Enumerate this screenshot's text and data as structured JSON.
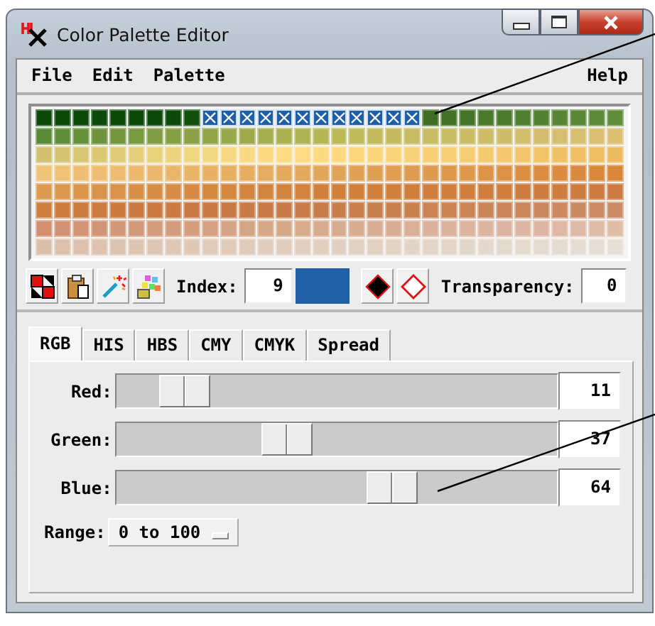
{
  "window": {
    "title": "Color Palette Editor"
  },
  "menu": [
    {
      "label": "File"
    },
    {
      "label": "Edit"
    },
    {
      "label": "Palette"
    },
    {
      "label": "Help"
    }
  ],
  "palette": {
    "rows": [
      {
        "cells": [
          {
            "color": "#0d4a0a",
            "selected": false
          },
          {
            "color": "#0d4a0a",
            "selected": false
          },
          {
            "color": "#0d4a0a",
            "selected": false
          },
          {
            "color": "#0d4a0a",
            "selected": false
          },
          {
            "color": "#0d4a0a",
            "selected": false
          },
          {
            "color": "#0d4a0a",
            "selected": false
          },
          {
            "color": "#0d4a0a",
            "selected": false
          },
          {
            "color": "#0d4a0a",
            "selected": false
          },
          {
            "color": "#10500c",
            "selected": false
          },
          {
            "color": "#1f5fa6",
            "selected": true
          },
          {
            "color": "#1f5fa6",
            "selected": true
          },
          {
            "color": "#1f5fa6",
            "selected": true
          },
          {
            "color": "#1f5fa6",
            "selected": true
          },
          {
            "color": "#1f5fa6",
            "selected": true
          },
          {
            "color": "#1f5fa6",
            "selected": true
          },
          {
            "color": "#1f5fa6",
            "selected": true
          },
          {
            "color": "#1f5fa6",
            "selected": true
          },
          {
            "color": "#1f5fa6",
            "selected": true
          },
          {
            "color": "#1f5fa6",
            "selected": true
          },
          {
            "color": "#1f5fa6",
            "selected": true
          },
          {
            "color": "#1f5fa6",
            "selected": true
          },
          {
            "color": "#3f6e22",
            "selected": false
          },
          {
            "color": "#437226",
            "selected": false
          },
          {
            "color": "#46752a",
            "selected": false
          },
          {
            "color": "#4a782c",
            "selected": false
          },
          {
            "color": "#4d7b2e",
            "selected": false
          },
          {
            "color": "#507e30",
            "selected": false
          },
          {
            "color": "#538132",
            "selected": false
          },
          {
            "color": "#568434",
            "selected": false
          },
          {
            "color": "#598736",
            "selected": false
          },
          {
            "color": "#5c8a38",
            "selected": false
          },
          {
            "color": "#5f8d3a",
            "selected": false
          }
        ]
      },
      {
        "cells": [
          {
            "color": "#5b8a36",
            "selected": false
          },
          {
            "color": "#618d38",
            "selected": false
          },
          {
            "color": "#67903a",
            "selected": false
          },
          {
            "color": "#6d933c",
            "selected": false
          },
          {
            "color": "#73963e",
            "selected": false
          },
          {
            "color": "#799940",
            "selected": false
          },
          {
            "color": "#7f9c42",
            "selected": false
          },
          {
            "color": "#859f44",
            "selected": false
          },
          {
            "color": "#8ba246",
            "selected": false
          },
          {
            "color": "#91a548",
            "selected": false
          },
          {
            "color": "#97a84a",
            "selected": false
          },
          {
            "color": "#9dab4c",
            "selected": false
          },
          {
            "color": "#a3ae4e",
            "selected": false
          },
          {
            "color": "#a9b150",
            "selected": false
          },
          {
            "color": "#afb452",
            "selected": false
          },
          {
            "color": "#b5b754",
            "selected": false
          },
          {
            "color": "#bbba56",
            "selected": false
          },
          {
            "color": "#bfbb5a",
            "selected": false
          },
          {
            "color": "#c1bb5e",
            "selected": false
          },
          {
            "color": "#c3bb60",
            "selected": false
          },
          {
            "color": "#c5bb62",
            "selected": false
          },
          {
            "color": "#c7bb64",
            "selected": false
          },
          {
            "color": "#c9bc66",
            "selected": false
          },
          {
            "color": "#cbbc68",
            "selected": false
          },
          {
            "color": "#cdbd6a",
            "selected": false
          },
          {
            "color": "#cfbd6c",
            "selected": false
          },
          {
            "color": "#d1be6e",
            "selected": false
          },
          {
            "color": "#d3be70",
            "selected": false
          },
          {
            "color": "#d5bf72",
            "selected": false
          },
          {
            "color": "#d7bf72",
            "selected": false
          },
          {
            "color": "#d9c074",
            "selected": false
          },
          {
            "color": "#dbc074",
            "selected": false
          }
        ]
      },
      {
        "cells": [
          {
            "color": "#d0c070",
            "selected": false
          },
          {
            "color": "#d4c372",
            "selected": false
          },
          {
            "color": "#d8c674",
            "selected": false
          },
          {
            "color": "#dcc976",
            "selected": false
          },
          {
            "color": "#e0cc78",
            "selected": false
          },
          {
            "color": "#e4cf7a",
            "selected": false
          },
          {
            "color": "#e8d27c",
            "selected": false
          },
          {
            "color": "#ecd47e",
            "selected": false
          },
          {
            "color": "#f0d680",
            "selected": false
          },
          {
            "color": "#f3d882",
            "selected": false
          },
          {
            "color": "#f6d984",
            "selected": false
          },
          {
            "color": "#f8da84",
            "selected": false
          },
          {
            "color": "#fadb84",
            "selected": false
          },
          {
            "color": "#fbdb84",
            "selected": false
          },
          {
            "color": "#fcdb84",
            "selected": false
          },
          {
            "color": "#fcda82",
            "selected": false
          },
          {
            "color": "#fcd980",
            "selected": false
          },
          {
            "color": "#fbd87e",
            "selected": false
          },
          {
            "color": "#fad67c",
            "selected": false
          },
          {
            "color": "#f9d47a",
            "selected": false
          },
          {
            "color": "#f8d278",
            "selected": false
          },
          {
            "color": "#f7d076",
            "selected": false
          },
          {
            "color": "#f6ce74",
            "selected": false
          },
          {
            "color": "#f5cc72",
            "selected": false
          },
          {
            "color": "#f4ca70",
            "selected": false
          },
          {
            "color": "#f3c86e",
            "selected": false
          },
          {
            "color": "#f2c66c",
            "selected": false
          },
          {
            "color": "#f1c46a",
            "selected": false
          },
          {
            "color": "#f0c268",
            "selected": false
          },
          {
            "color": "#efc066",
            "selected": false
          },
          {
            "color": "#eebe64",
            "selected": false
          },
          {
            "color": "#edbc62",
            "selected": false
          }
        ]
      },
      {
        "cells": [
          {
            "color": "#f0c478",
            "selected": false
          },
          {
            "color": "#efc276",
            "selected": false
          },
          {
            "color": "#eec074",
            "selected": false
          },
          {
            "color": "#edbe72",
            "selected": false
          },
          {
            "color": "#ecbc70",
            "selected": false
          },
          {
            "color": "#ebba6e",
            "selected": false
          },
          {
            "color": "#eab86c",
            "selected": false
          },
          {
            "color": "#e9b66a",
            "selected": false
          },
          {
            "color": "#e8b468",
            "selected": false
          },
          {
            "color": "#e7b266",
            "selected": false
          },
          {
            "color": "#e6b064",
            "selected": false
          },
          {
            "color": "#e5ae62",
            "selected": false
          },
          {
            "color": "#e4ac60",
            "selected": false
          },
          {
            "color": "#e3aa5e",
            "selected": false
          },
          {
            "color": "#e2a85c",
            "selected": false
          },
          {
            "color": "#e1a65a",
            "selected": false
          },
          {
            "color": "#e0a458",
            "selected": false
          },
          {
            "color": "#e0a256",
            "selected": false
          },
          {
            "color": "#dfa054",
            "selected": false
          },
          {
            "color": "#df9e52",
            "selected": false
          },
          {
            "color": "#de9c50",
            "selected": false
          },
          {
            "color": "#de9a4e",
            "selected": false
          },
          {
            "color": "#dd984c",
            "selected": false
          },
          {
            "color": "#dd964a",
            "selected": false
          },
          {
            "color": "#dc9448",
            "selected": false
          },
          {
            "color": "#dc9246",
            "selected": false
          },
          {
            "color": "#db9044",
            "selected": false
          },
          {
            "color": "#db8e42",
            "selected": false
          },
          {
            "color": "#da8c40",
            "selected": false
          },
          {
            "color": "#da8a3e",
            "selected": false
          },
          {
            "color": "#d9883c",
            "selected": false
          },
          {
            "color": "#d9863a",
            "selected": false
          }
        ]
      },
      {
        "cells": [
          {
            "color": "#dc9a52",
            "selected": false
          },
          {
            "color": "#db9850",
            "selected": false
          },
          {
            "color": "#da964e",
            "selected": false
          },
          {
            "color": "#d9944c",
            "selected": false
          },
          {
            "color": "#d8924a",
            "selected": false
          },
          {
            "color": "#d79048",
            "selected": false
          },
          {
            "color": "#d68e46",
            "selected": false
          },
          {
            "color": "#d58c44",
            "selected": false
          },
          {
            "color": "#d48a42",
            "selected": false
          },
          {
            "color": "#d38840",
            "selected": false
          },
          {
            "color": "#d3873f",
            "selected": false
          },
          {
            "color": "#d2863e",
            "selected": false
          },
          {
            "color": "#d2853e",
            "selected": false
          },
          {
            "color": "#d1843d",
            "selected": false
          },
          {
            "color": "#d1833d",
            "selected": false
          },
          {
            "color": "#d0823c",
            "selected": false
          },
          {
            "color": "#d0823c",
            "selected": false
          },
          {
            "color": "#d0813c",
            "selected": false
          },
          {
            "color": "#cf803c",
            "selected": false
          },
          {
            "color": "#cf803c",
            "selected": false
          },
          {
            "color": "#cf7f3c",
            "selected": false
          },
          {
            "color": "#cf7f3d",
            "selected": false
          },
          {
            "color": "#ce7e3d",
            "selected": false
          },
          {
            "color": "#ce7e3e",
            "selected": false
          },
          {
            "color": "#ce7e3e",
            "selected": false
          },
          {
            "color": "#ce7e3f",
            "selected": false
          },
          {
            "color": "#cd7d3f",
            "selected": false
          },
          {
            "color": "#cd7d40",
            "selected": false
          },
          {
            "color": "#cd7d40",
            "selected": false
          },
          {
            "color": "#cd7d41",
            "selected": false
          },
          {
            "color": "#cc7c41",
            "selected": false
          },
          {
            "color": "#cc7c42",
            "selected": false
          }
        ]
      },
      {
        "cells": [
          {
            "color": "#cf7e3e",
            "selected": false
          },
          {
            "color": "#ce7d3e",
            "selected": false
          },
          {
            "color": "#cd7c3f",
            "selected": false
          },
          {
            "color": "#cc7c40",
            "selected": false
          },
          {
            "color": "#cb7b40",
            "selected": false
          },
          {
            "color": "#cb7b41",
            "selected": false
          },
          {
            "color": "#ca7a42",
            "selected": false
          },
          {
            "color": "#ca7a43",
            "selected": false
          },
          {
            "color": "#c97a44",
            "selected": false
          },
          {
            "color": "#c97a45",
            "selected": false
          },
          {
            "color": "#c87a46",
            "selected": false
          },
          {
            "color": "#c87a47",
            "selected": false
          },
          {
            "color": "#c87b48",
            "selected": false
          },
          {
            "color": "#c87b49",
            "selected": false
          },
          {
            "color": "#c87c4a",
            "selected": false
          },
          {
            "color": "#c87c4b",
            "selected": false
          },
          {
            "color": "#c87d4c",
            "selected": false
          },
          {
            "color": "#c87e4d",
            "selected": false
          },
          {
            "color": "#c87f4e",
            "selected": false
          },
          {
            "color": "#c9804f",
            "selected": false
          },
          {
            "color": "#c98150",
            "selected": false
          },
          {
            "color": "#c98252",
            "selected": false
          },
          {
            "color": "#c98354",
            "selected": false
          },
          {
            "color": "#ca8456",
            "selected": false
          },
          {
            "color": "#ca8558",
            "selected": false
          },
          {
            "color": "#ca865a",
            "selected": false
          },
          {
            "color": "#cb875c",
            "selected": false
          },
          {
            "color": "#cb885e",
            "selected": false
          },
          {
            "color": "#cb8960",
            "selected": false
          },
          {
            "color": "#cc8a62",
            "selected": false
          },
          {
            "color": "#cc8b64",
            "selected": false
          },
          {
            "color": "#cc8c66",
            "selected": false
          }
        ]
      },
      {
        "cells": [
          {
            "color": "#d09070",
            "selected": false
          },
          {
            "color": "#d09272",
            "selected": false
          },
          {
            "color": "#d19474",
            "selected": false
          },
          {
            "color": "#d19676",
            "selected": false
          },
          {
            "color": "#d29878",
            "selected": false
          },
          {
            "color": "#d29a7a",
            "selected": false
          },
          {
            "color": "#d39c7c",
            "selected": false
          },
          {
            "color": "#d39e7e",
            "selected": false
          },
          {
            "color": "#d4a080",
            "selected": false
          },
          {
            "color": "#d4a282",
            "selected": false
          },
          {
            "color": "#d5a484",
            "selected": false
          },
          {
            "color": "#d5a686",
            "selected": false
          },
          {
            "color": "#d6a888",
            "selected": false
          },
          {
            "color": "#d6a98a",
            "selected": false
          },
          {
            "color": "#d7aa8c",
            "selected": false
          },
          {
            "color": "#d7ab8e",
            "selected": false
          },
          {
            "color": "#d8ac90",
            "selected": false
          },
          {
            "color": "#d8ad92",
            "selected": false
          },
          {
            "color": "#d9ae94",
            "selected": false
          },
          {
            "color": "#d9af96",
            "selected": false
          },
          {
            "color": "#dab098",
            "selected": false
          },
          {
            "color": "#dab19a",
            "selected": false
          },
          {
            "color": "#dbb29c",
            "selected": false
          },
          {
            "color": "#dbb39e",
            "selected": false
          },
          {
            "color": "#dcb4a0",
            "selected": false
          },
          {
            "color": "#dcb5a2",
            "selected": false
          },
          {
            "color": "#ddb6a3",
            "selected": false
          },
          {
            "color": "#ddb7a4",
            "selected": false
          },
          {
            "color": "#deb8a5",
            "selected": false
          },
          {
            "color": "#debaa6",
            "selected": false
          },
          {
            "color": "#dfbca7",
            "selected": false
          },
          {
            "color": "#e0bea8",
            "selected": false
          }
        ]
      },
      {
        "cells": [
          {
            "color": "#dcc0ac",
            "selected": false
          },
          {
            "color": "#dcc1ad",
            "selected": false
          },
          {
            "color": "#dcc2ae",
            "selected": false
          },
          {
            "color": "#ddc3b0",
            "selected": false
          },
          {
            "color": "#ddc4b1",
            "selected": false
          },
          {
            "color": "#ddc5b2",
            "selected": false
          },
          {
            "color": "#dec6b4",
            "selected": false
          },
          {
            "color": "#dec7b5",
            "selected": false
          },
          {
            "color": "#dec8b6",
            "selected": false
          },
          {
            "color": "#dfc9b8",
            "selected": false
          },
          {
            "color": "#dfcab9",
            "selected": false
          },
          {
            "color": "#dfcbba",
            "selected": false
          },
          {
            "color": "#e0ccbc",
            "selected": false
          },
          {
            "color": "#e0cdbd",
            "selected": false
          },
          {
            "color": "#e0cebe",
            "selected": false
          },
          {
            "color": "#e1cfc0",
            "selected": false
          },
          {
            "color": "#e1d0c1",
            "selected": false
          },
          {
            "color": "#e1d1c2",
            "selected": false
          },
          {
            "color": "#e2d2c4",
            "selected": false
          },
          {
            "color": "#e2d3c5",
            "selected": false
          },
          {
            "color": "#e2d4c6",
            "selected": false
          },
          {
            "color": "#e3d5c8",
            "selected": false
          },
          {
            "color": "#e3d6c9",
            "selected": false
          },
          {
            "color": "#e3d7ca",
            "selected": false
          },
          {
            "color": "#e4d8cc",
            "selected": false
          },
          {
            "color": "#e4d9cd",
            "selected": false
          },
          {
            "color": "#e4dace",
            "selected": false
          },
          {
            "color": "#e5dbd0",
            "selected": false
          },
          {
            "color": "#e5dcd1",
            "selected": false
          },
          {
            "color": "#e5ddd2",
            "selected": false
          },
          {
            "color": "#e6ded4",
            "selected": false
          },
          {
            "color": "#e6dfd6",
            "selected": false
          }
        ]
      }
    ]
  },
  "toolbar": {
    "index_label": "Index:",
    "index_value": "9",
    "transparency_label": "Transparency:",
    "transparency_value": "0"
  },
  "tabs": [
    {
      "label": "RGB",
      "selected": true
    },
    {
      "label": "HIS",
      "selected": false
    },
    {
      "label": "HBS",
      "selected": false
    },
    {
      "label": "CMY",
      "selected": false
    },
    {
      "label": "CMYK",
      "selected": false
    },
    {
      "label": "Spread",
      "selected": false
    }
  ],
  "sliders": [
    {
      "label": "Red:",
      "level": 0.11,
      "value": "11"
    },
    {
      "label": "Green:",
      "level": 0.37,
      "value": "37"
    },
    {
      "label": "Blue:",
      "level": 0.64,
      "value": "64"
    }
  ],
  "range": {
    "label": "Range:",
    "value": "0 to 100"
  }
}
